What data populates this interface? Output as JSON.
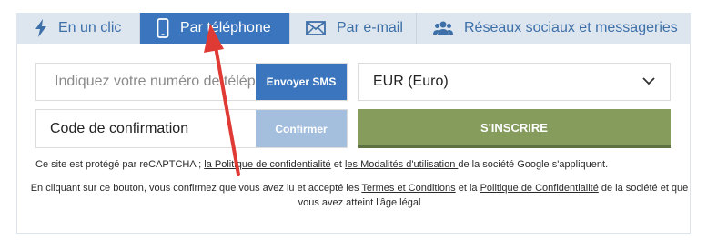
{
  "tabs": [
    {
      "label": "En un clic",
      "icon": "lightning-icon",
      "active": false
    },
    {
      "label": "Par téléphone",
      "icon": "mobile-phone-icon",
      "active": true
    },
    {
      "label": "Par e-mail",
      "icon": "envelope-icon",
      "active": false
    },
    {
      "label": "Réseaux sociaux et messageries",
      "icon": "users-icon",
      "active": false
    }
  ],
  "form": {
    "phone_placeholder": "Indiquez votre numéro de téléphone",
    "send_sms_label": "Envoyer SMS",
    "currency_value": "EUR (Euro)",
    "code_label": "Code de confirmation",
    "confirm_label": "Confirmer",
    "signup_label": "S'INSCRIRE"
  },
  "notes": {
    "recaptcha_prefix": "Ce site est protégé par reCAPTCHA ; ",
    "privacy_link": "la Politique de confidentialité",
    "and": " et ",
    "terms_link": "les Modalités d'utilisation ",
    "recaptcha_suffix": "de la société Google s'appliquent.",
    "consent_prefix": "En cliquant sur ce bouton, vous confirmez que vous avez lu et accepté les ",
    "conditions_link": "Termes et Conditions",
    "consent_mid": " et la ",
    "privacy_policy_link": "Politique de Confidentialité",
    "consent_suffix": " de la société et que vous avez atteint l'âge légal"
  },
  "colors": {
    "tab_bar": "#dde6ef",
    "active_tab": "#3a75bd",
    "signup_button": "#869c5d",
    "annotation_arrow": "#e03a35"
  }
}
